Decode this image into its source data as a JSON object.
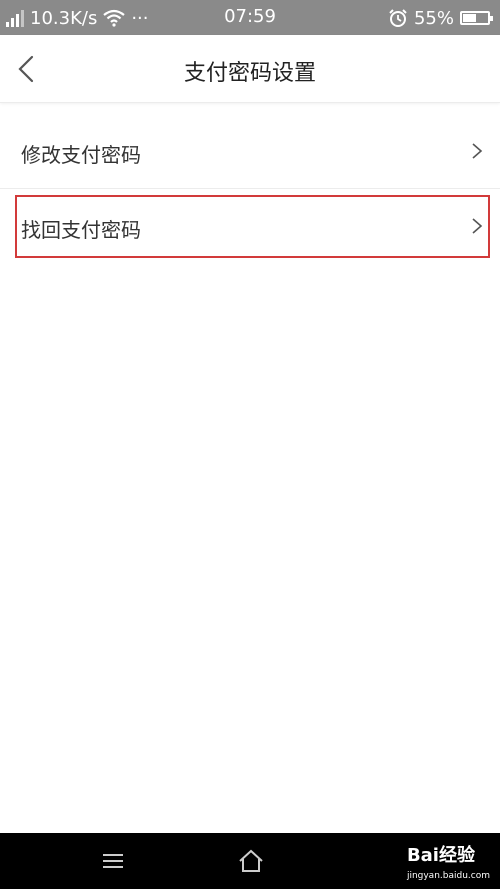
{
  "status_bar": {
    "net_speed": "10.3K/s",
    "more": "···",
    "time": "07:59",
    "battery": "55%",
    "battery_level": 0.55
  },
  "header": {
    "title": "支付密码设置"
  },
  "menu": {
    "items": [
      {
        "label": "修改支付密码"
      },
      {
        "label": "找回支付密码"
      }
    ]
  },
  "watermark": {
    "brand": "Bai经验",
    "url": "jingyan.baidu.com"
  },
  "colors": {
    "status_bar_bg": "#8a8a8a",
    "highlight_border": "#d23a3a",
    "nav_bg": "#000000"
  }
}
